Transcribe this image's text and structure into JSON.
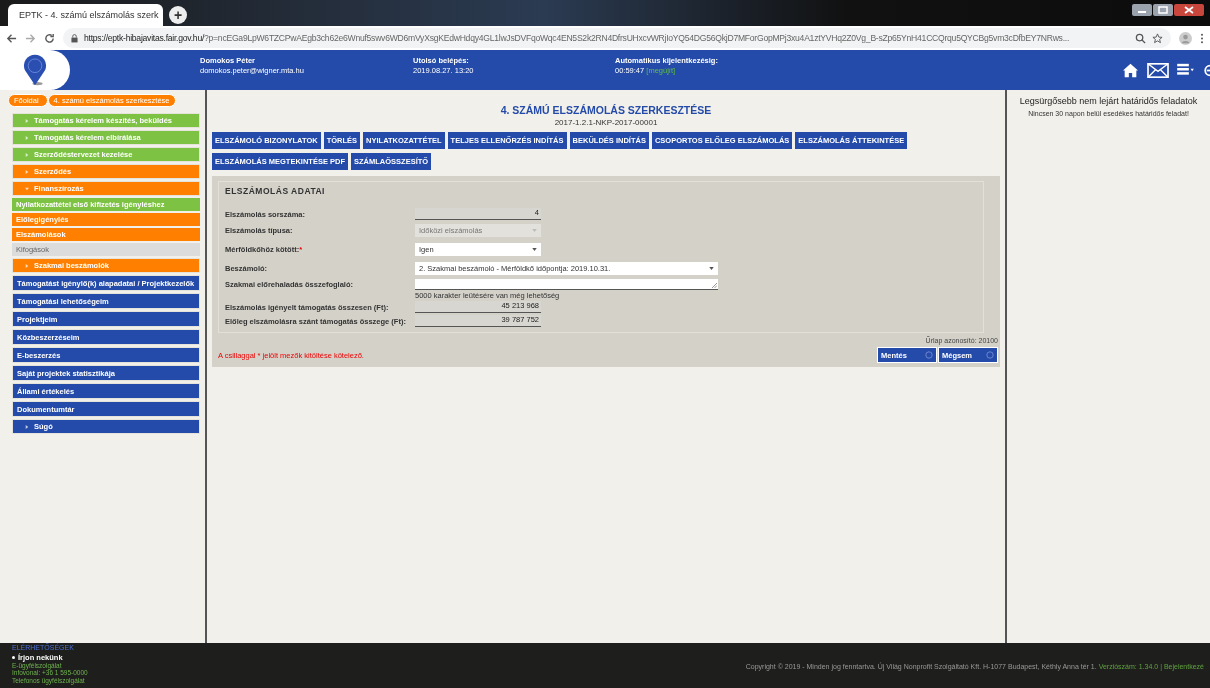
{
  "browser": {
    "tab_title": "EPTK - 4. számú elszámolás szerk",
    "new_tab": "+",
    "url_host": "https://eptk-hibajavitas.fair.gov.hu/",
    "url_rest": "?p=ncEGa9LpW6TZCPwAEgb3ch62e6Wnuf5swv6WD6mVyXsgKEdwHdqy4GL1lwJsDVFqoWqc4EN5S2k2RN4DfrsUHxcvWRjIoYQ54DG56QkjD7MForGopMPj3xu4A1ztYVHq2Z0Vg_B-sZp65YnH41CCQrqu5QYCBg5vm3cDfbEY7NRws..."
  },
  "header": {
    "user_name": "Domokos Péter",
    "user_email": "domokos.peter@wigner.mta.hu",
    "last_login_label": "Utolsó belépés:",
    "last_login": "2019.08.27. 13:20",
    "logout_label": "Automatikus kijelentkezésig:",
    "logout_time": "00:59:47",
    "renew": "[megújít]"
  },
  "breadcrumb": [
    {
      "label": "Főoldal"
    },
    {
      "label": "4. számú elszámolás szerkesztése"
    }
  ],
  "sidebar": {
    "items": [
      {
        "label": "Támogatás kérelem készítés, beküldés",
        "kind": "section",
        "color": "#7dc243",
        "expanded": false
      },
      {
        "label": "Támogatás kérelem elbírálása",
        "kind": "section",
        "color": "#7dc243",
        "expanded": false
      },
      {
        "label": "Szerződéstervezet kezelése",
        "kind": "section",
        "color": "#7dc243",
        "expanded": false
      },
      {
        "label": "Szerződés",
        "kind": "section",
        "color": "#ff8000",
        "expanded": false
      },
      {
        "label": "Finanszírozás",
        "kind": "section",
        "color": "#ff8000",
        "expanded": true
      },
      {
        "label": "Nyilatkozattétel első kifizetés igényléshez",
        "kind": "sub",
        "color": "#7dc243"
      },
      {
        "label": "Előlegigénylés",
        "kind": "sub",
        "color": "#ff8000"
      },
      {
        "label": "Elszámolások",
        "kind": "sub",
        "color": "#ff8000"
      },
      {
        "label": "Kifogások",
        "kind": "sub",
        "color": "#dcdcdc"
      },
      {
        "label": "Szakmai beszámolók",
        "kind": "section",
        "color": "#ff8000",
        "expanded": false
      },
      {
        "label": "Támogatást igénylő(k) alapadatai / Projektkezelők",
        "kind": "link",
        "color": "#244ba9"
      },
      {
        "label": "Támogatási lehetőségeim",
        "kind": "link",
        "color": "#244ba9"
      },
      {
        "label": "Projektjeim",
        "kind": "link",
        "color": "#244ba9"
      },
      {
        "label": "Közbeszerzéseim",
        "kind": "link",
        "color": "#244ba9"
      },
      {
        "label": "E-beszerzés",
        "kind": "link",
        "color": "#244ba9"
      },
      {
        "label": "Saját projektek statisztikája",
        "kind": "link",
        "color": "#244ba9"
      },
      {
        "label": "Állami értékelés",
        "kind": "link",
        "color": "#244ba9"
      },
      {
        "label": "Dokumentumtár",
        "kind": "link",
        "color": "#244ba9"
      },
      {
        "label": "Súgó",
        "kind": "section",
        "color": "#244ba9",
        "expanded": false
      }
    ]
  },
  "page": {
    "title": "4. SZÁMÚ ELSZÁMOLÁS SZERKESZTÉSE",
    "subtitle": "2017-1.2.1-NKP-2017-00001",
    "actions": [
      "ELSZÁMOLÓ BIZONYLATOK",
      "TÖRLÉS",
      "NYILATKOZATTÉTEL",
      "TELJES ELLENŐRZÉS INDÍTÁS",
      "BEKÜLDÉS INDÍTÁS",
      "CSOPORTOS ELŐLEG ELSZÁMOLÁS",
      "ELSZÁMOLÁS ÁTTEKINTÉSE",
      "ELSZÁMOLÁS MEGTEKINTÉSE PDF",
      "SZÁMLAÖSSZESÍTŐ"
    ],
    "form": {
      "title": "ELSZÁMOLÁS ADATAI",
      "required_mark": "*",
      "fields": [
        {
          "label": "Elszámolás sorszáma:",
          "kind": "value",
          "value": "4",
          "required": false
        },
        {
          "label": "Elszámolás típusa:",
          "kind": "select",
          "value": "Időközi elszámolás",
          "disabled": true,
          "required": false
        },
        {
          "label": "Mérföldkőhöz kötött:",
          "kind": "select",
          "value": "Igen",
          "disabled": false,
          "required": true
        },
        {
          "label": "Beszámoló:",
          "kind": "wide-select",
          "value": "2. Szakmai beszámoló - Mérföldkő időpontja: 2019.10.31.",
          "required": false
        },
        {
          "label": "Szakmai előrehaladás összefoglaló:",
          "kind": "textarea",
          "hint": "5000 karakter leütésére van még lehetőség",
          "required": false
        },
        {
          "label": "Elszámolás igényelt támogatás összesen (Ft):",
          "kind": "value",
          "value": "45 213 968",
          "required": false
        },
        {
          "label": "Előleg elszámolásra szánt támogatás összege (Ft):",
          "kind": "value",
          "value": "39 787 752",
          "required": false
        }
      ]
    },
    "form_id": "Űrlap azonosító: 20100",
    "required_note": "A csillaggal * jelölt mezők kitöltése kötelező.",
    "buttons": [
      "Mentés",
      "Mégsem"
    ]
  },
  "right_panel": {
    "title": "Legsürgősebb nem lejárt határidős feladatok",
    "empty": "Nincsen 30 napon belül esedékes határidős feladat!"
  },
  "footer": {
    "heading": "ELÉRHETŐSÉGEK",
    "contact_title": "Írjon nekünk",
    "links": [
      "E-ügyfélszolgálat",
      "Infovonal: +36 1 595-0000",
      "Telefonos ügyfélszolgálat"
    ],
    "copyright": "Copyright © 2019 - Minden jog fenntartva. Új Világ Nonprofit Szolgáltató Kft. H-1077 Budapest, Kéthly Anna tér 1.",
    "version": "Verziószám: 1.34.0",
    "login": "| Bejelentkezé"
  }
}
